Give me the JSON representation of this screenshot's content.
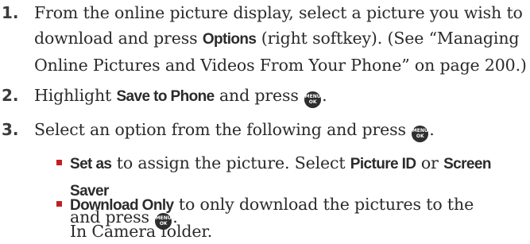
{
  "steps": [
    {
      "number": "1.",
      "lines": [
        {
          "t1": "From the online picture display, select a picture you wish to"
        },
        {
          "t1": "download and press ",
          "kw": "Options",
          "t2": " (right softkey). (See “Managing"
        },
        {
          "t1": "Online Pictures and Videos From Your Phone” on page 200.)"
        }
      ]
    },
    {
      "number": "2.",
      "t1": "Highlight ",
      "kw": "Save to Phone",
      "t2": " and press "
    },
    {
      "number": "3.",
      "t1": "Select an option from the following and press "
    }
  ],
  "options": [
    {
      "kw": "Set as",
      "t1": " to assign the picture. Select ",
      "kw2": "Picture ID",
      "t2": " or ",
      "kw3": "Screen Saver",
      "t3": "and press "
    },
    {
      "kw": "Download Only",
      "t1": " to only download the pictures to the",
      "t2": "In Camera folder."
    }
  ],
  "icons": {
    "menu_ok": {
      "name": "menu-ok-key-icon",
      "top": "MENU",
      "bottom": "OK"
    }
  },
  "colors": {
    "text": "#2b2b2b",
    "bullet": "#c02020",
    "icon_bg": "#2e2e2e"
  }
}
